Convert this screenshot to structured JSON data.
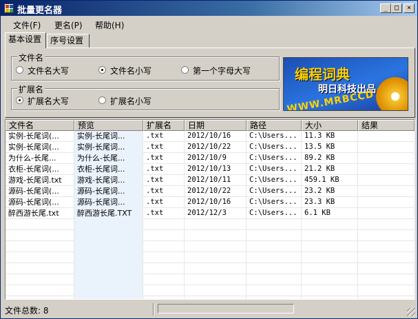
{
  "window": {
    "title": "批量更名器"
  },
  "menu": [
    "文件(F)",
    "更名(P)",
    "帮助(H)"
  ],
  "tabs": [
    "基本设置",
    "序号设置"
  ],
  "groups": {
    "filename": {
      "label": "文件名",
      "options": [
        "文件名大写",
        "文件名小写",
        "第一个字母大写"
      ],
      "selected": 1
    },
    "extension": {
      "label": "扩展名",
      "options": [
        "扩展名大写",
        "扩展名小写"
      ],
      "selected": 0
    }
  },
  "banner": {
    "line1": "编程词典",
    "line2": "明日科技出品",
    "line3": "WWW.MRBCCD"
  },
  "table": {
    "columns": [
      "文件名",
      "预览",
      "扩展名",
      "日期",
      "路径",
      "大小",
      "结果"
    ],
    "rows": [
      [
        "实例-长尾词(...",
        "实例-长尾词...",
        ".txt",
        "2012/10/16",
        "C:\\Users...",
        "11.3 KB",
        ""
      ],
      [
        "实例-长尾词(...",
        "实例-长尾词...",
        ".txt",
        "2012/10/22",
        "C:\\Users...",
        "13.5 KB",
        ""
      ],
      [
        "为什么-长尾...",
        "为什么-长尾...",
        ".txt",
        "2012/10/9",
        "C:\\Users...",
        "89.2 KB",
        ""
      ],
      [
        "衣柜-长尾词(...",
        "衣柜-长尾词...",
        ".txt",
        "2012/10/13",
        "C:\\Users...",
        "21.2 KB",
        ""
      ],
      [
        "游戏-长尾词.txt",
        "游戏-长尾词...",
        ".txt",
        "2012/10/11",
        "C:\\Users...",
        "459.1 KB",
        ""
      ],
      [
        "源码-长尾词(...",
        "源码-长尾词...",
        ".txt",
        "2012/10/22",
        "C:\\Users...",
        "23.2 KB",
        ""
      ],
      [
        "源码-长尾词(...",
        "源码-长尾词...",
        ".txt",
        "2012/10/16",
        "C:\\Users...",
        "23.3 KB",
        ""
      ],
      [
        "醉西游长尾.txt",
        "醉西游长尾.TXT",
        ".txt",
        "2012/12/3",
        "C:\\Users...",
        "6.1 KB",
        ""
      ]
    ]
  },
  "status": {
    "text": "文件总数: 8"
  },
  "window_buttons": {
    "minimize": "_",
    "maximize": "□",
    "close": "×"
  }
}
